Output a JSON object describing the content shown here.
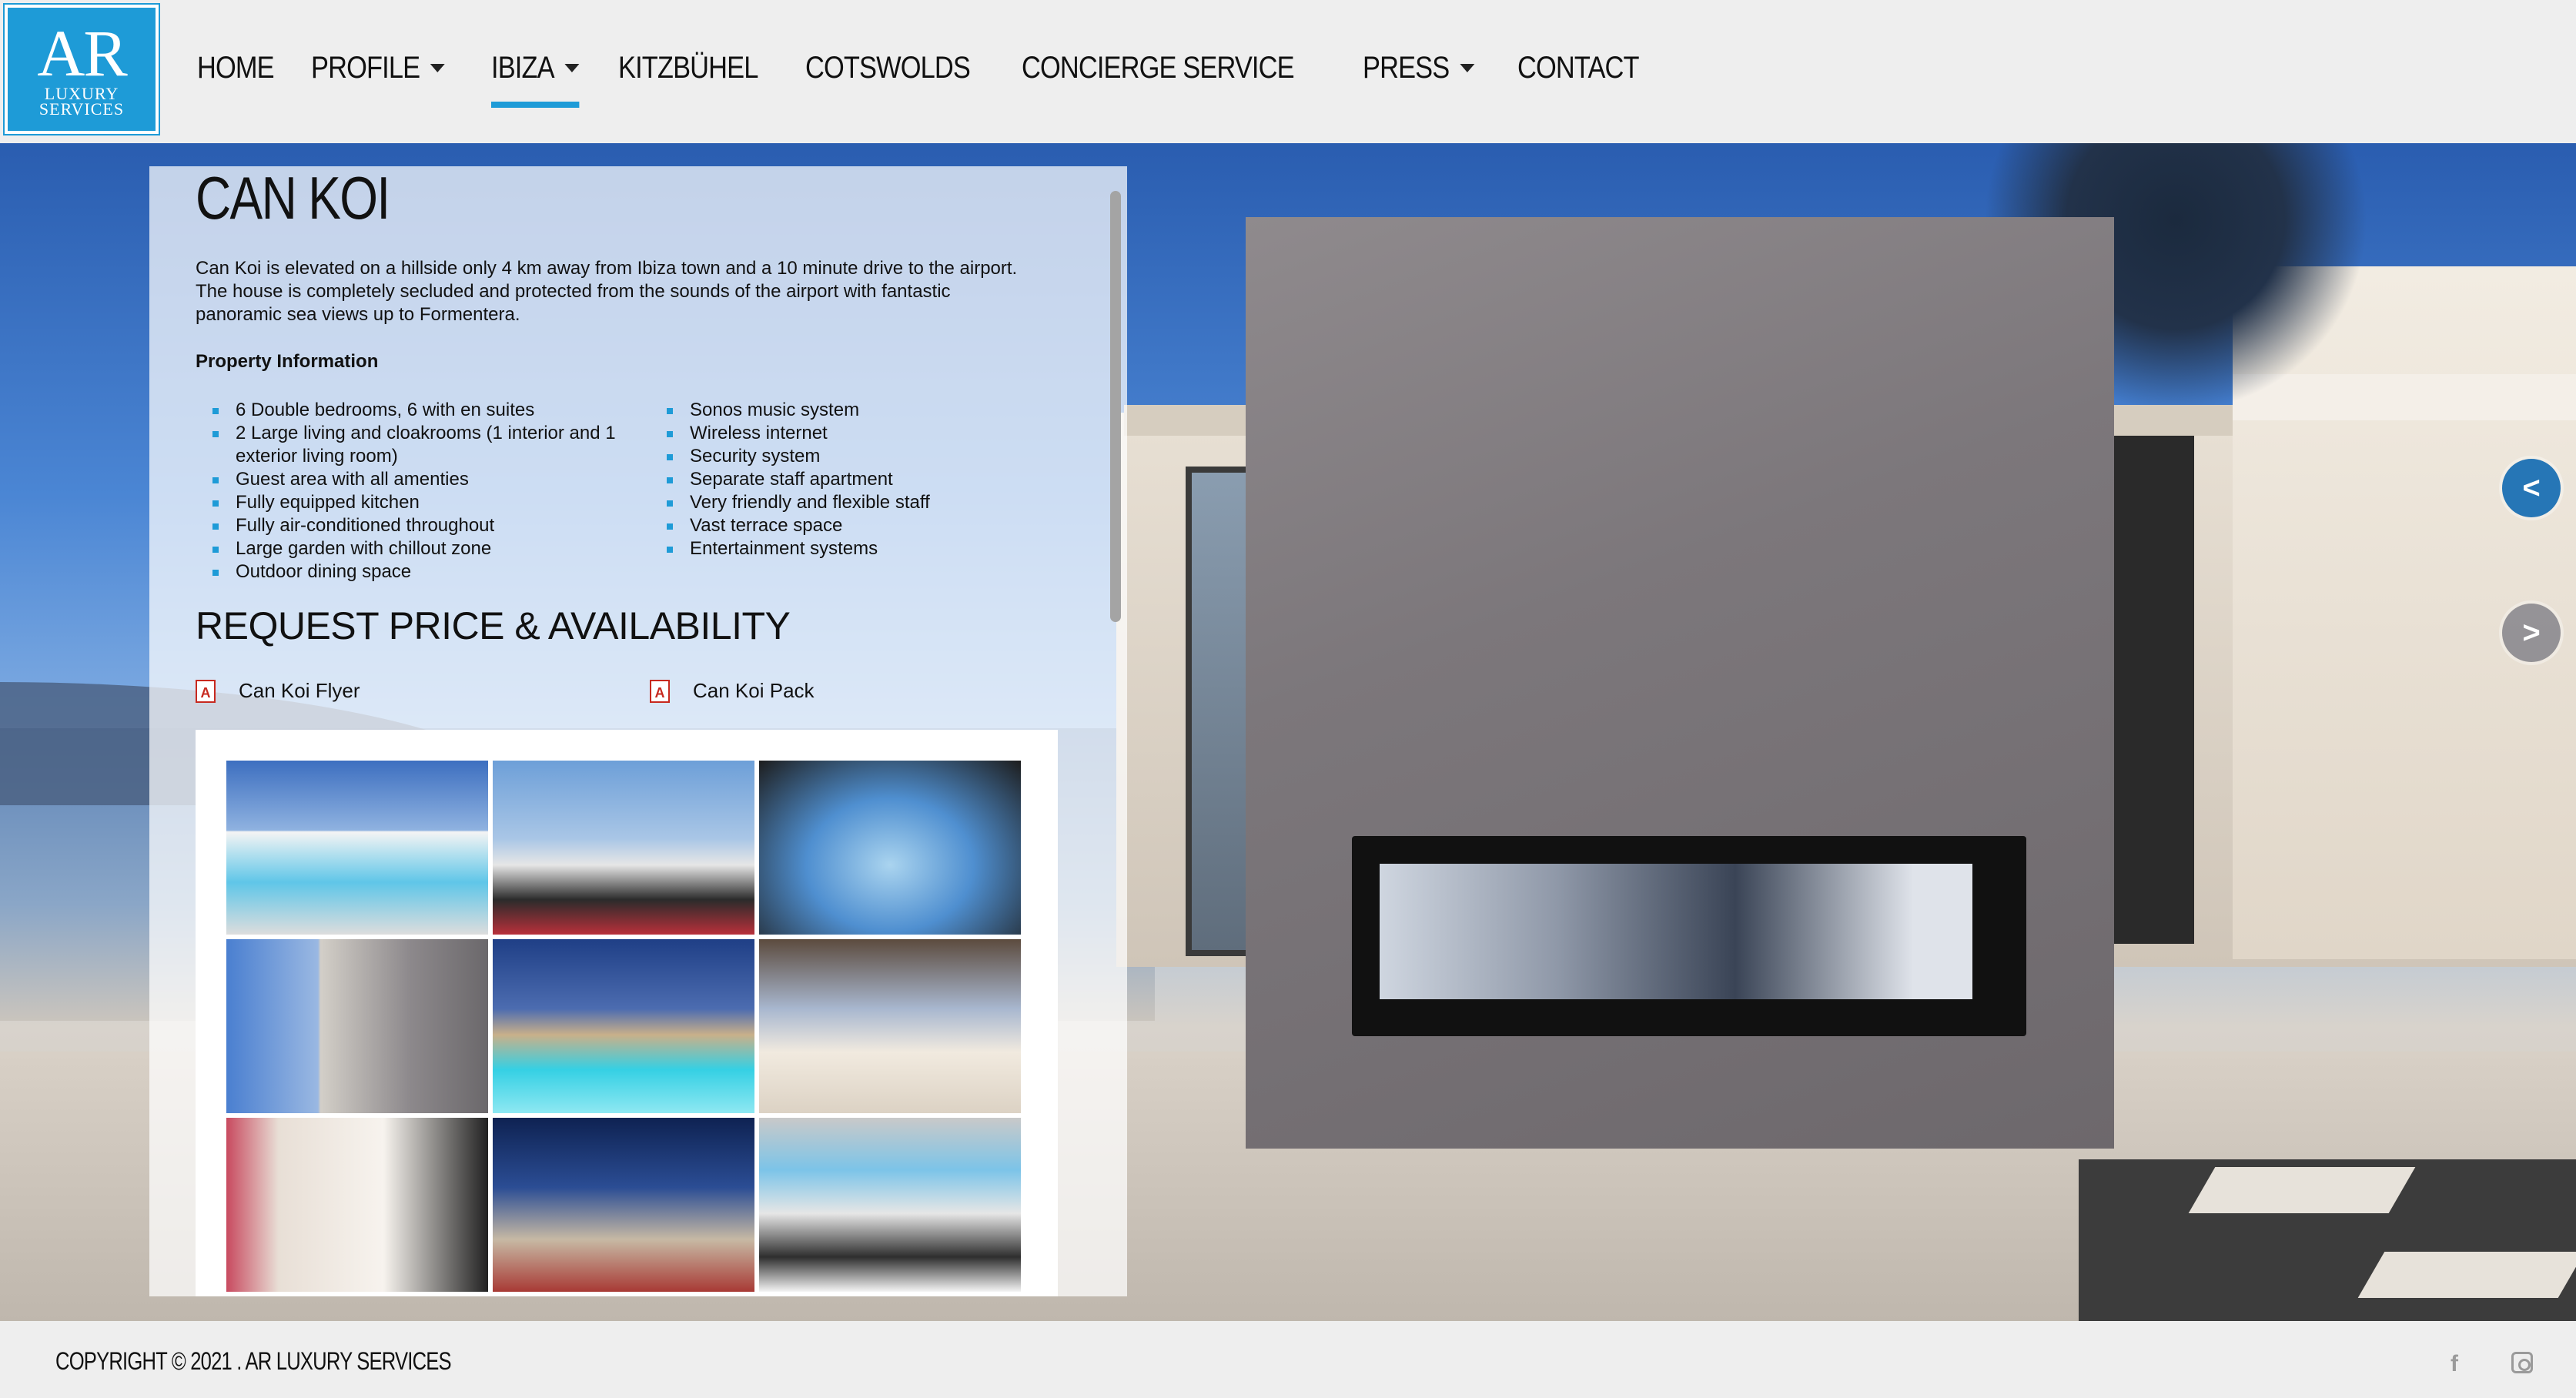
{
  "logo": {
    "mono": "AR",
    "line1": "LUXURY",
    "line2": "SERVICES"
  },
  "nav": {
    "items": [
      {
        "label": "HOME",
        "dropdown": false,
        "active": false
      },
      {
        "label": "PROFILE",
        "dropdown": true,
        "active": false
      },
      {
        "label": "IBIZA",
        "dropdown": true,
        "active": true
      },
      {
        "label": "KITZBÜHEL",
        "dropdown": false,
        "active": false
      },
      {
        "label": "COTSWOLDS",
        "dropdown": false,
        "active": false
      },
      {
        "label": "CONCIERGE SERVICE",
        "dropdown": false,
        "active": false
      },
      {
        "label": "PRESS",
        "dropdown": true,
        "active": false
      },
      {
        "label": "CONTACT",
        "dropdown": false,
        "active": false
      }
    ],
    "accent": "#1e9bd7"
  },
  "property": {
    "title": "CAN KOI",
    "description": "Can Koi is elevated on a hillside only 4 km away from Ibiza town and a 10 minute drive to the airport. The house is completely secluded and protected from the sounds of the airport with fantastic panoramic sea views up to Formentera.",
    "info_heading": "Property Information",
    "features_left": [
      "6 Double bedrooms, 6 with en suites",
      "2 Large living and cloakrooms (1 interior and 1 exterior living room)",
      "Guest area with all amenties",
      "Fully equipped kitchen",
      "Fully air-conditioned throughout",
      "Large garden with chillout zone",
      "Outdoor dining space"
    ],
    "features_right": [
      "Sonos music system",
      "Wireless internet",
      "Security system",
      "Separate staff apartment",
      "Very friendly and flexible staff",
      "Vast terrace space",
      "Entertainment systems"
    ],
    "request_heading": "REQUEST PRICE & AVAILABILITY",
    "documents": [
      {
        "label": "Can Koi Flyer",
        "icon": "pdf-icon"
      },
      {
        "label": "Can Koi Pack",
        "icon": "pdf-icon"
      }
    ]
  },
  "slider": {
    "prev_icon": "chevron-left-icon",
    "next_icon": "chevron-right-icon",
    "prev_glyph": "<",
    "next_glyph": ">"
  },
  "footer": {
    "copyright": "COPYRIGHT © 2021 . AR LUXURY SERVICES",
    "social": [
      {
        "name": "facebook-icon",
        "glyph": "f"
      },
      {
        "name": "instagram-icon",
        "glyph": ""
      }
    ]
  }
}
